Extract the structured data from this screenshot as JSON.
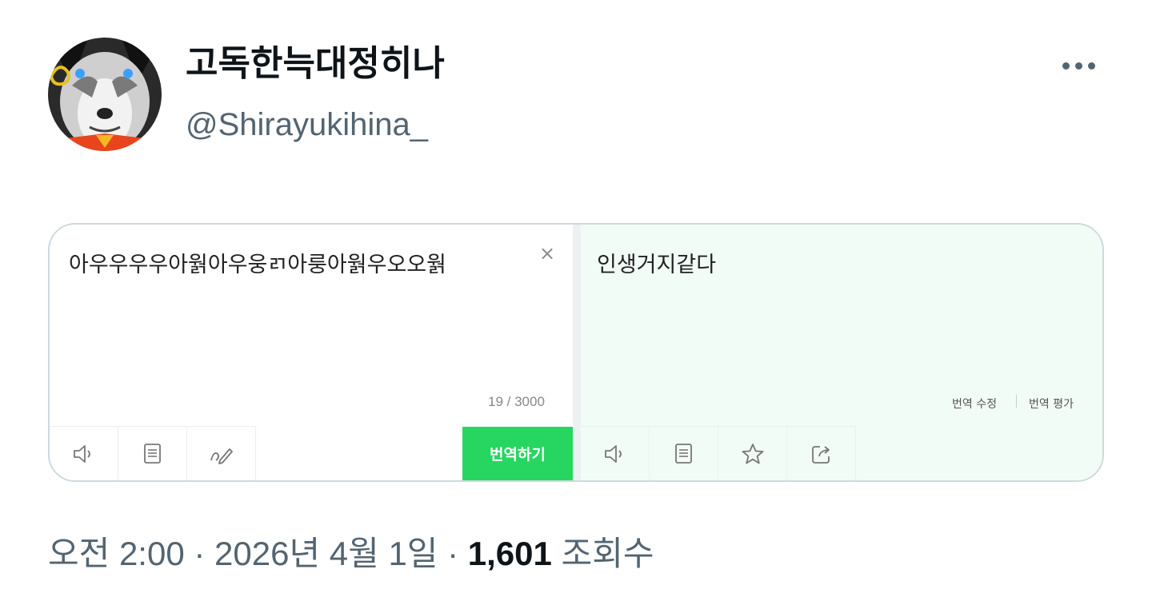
{
  "author": {
    "display_name": "고독한늑대정히나",
    "handle": "@Shirayukihina_"
  },
  "translator": {
    "source_text": "아우우우우아웕아우웅ㄺ아룽아웕우오오웕",
    "char_count": "19 / 3000",
    "clear_glyph": "×",
    "translate_button": "번역하기",
    "target_text": "인생거지같다",
    "edit_link": "번역 수정",
    "rate_link": "번역 평가",
    "source_tools": [
      "speaker-icon",
      "dictionary-icon",
      "handwriting-icon"
    ],
    "target_tools": [
      "speaker-icon",
      "dictionary-icon",
      "star-icon",
      "share-icon"
    ],
    "accent_color": "#27d660",
    "result_bg_color": "#f1fcf6"
  },
  "meta": {
    "time": "오전 2:00",
    "separator": " · ",
    "date": "2026년 4월 1일",
    "views_count": "1,601",
    "views_label": " 조회수"
  }
}
